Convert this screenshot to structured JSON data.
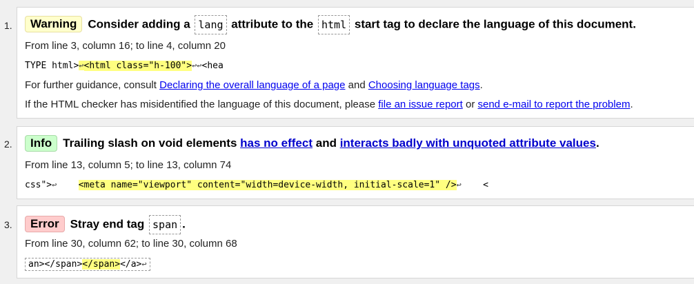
{
  "messages": [
    {
      "number": "1.",
      "type": "Warning",
      "title_parts": [
        "Consider adding a",
        "lang",
        "attribute to the",
        "html",
        "start tag to declare the language of this document."
      ],
      "location": "From line 3, column 16; to line 4, column 20",
      "extract": {
        "before": "TYPE html>",
        "lf1": "↩",
        "highlight": "<html class=\"h-100\">",
        "lf2": "↩↩",
        "after": "<hea"
      },
      "guidance": {
        "prefix": "For further guidance, consult",
        "link1": "Declaring the overall language of a page",
        "and": "and",
        "link2": "Choosing language tags",
        "suffix": "."
      },
      "misidentified": {
        "prefix": "If the HTML checker has misidentified the language of this document, please",
        "link1": "file an issue report",
        "or": "or",
        "link2": "send e-mail to report the problem",
        "suffix": "."
      }
    },
    {
      "number": "2.",
      "type": "Info",
      "title_prefix": "Trailing slash on void elements",
      "link1": "has no effect",
      "and": "and",
      "link2": "interacts badly with unquoted attribute values",
      "title_suffix": ".",
      "location": "From line 13, column 5; to line 13, column 74",
      "extract": {
        "before": "css\">",
        "lf1": "↩",
        "gap": "    ",
        "highlight": "<meta name=\"viewport\" content=\"width=device-width, initial-scale=1\" />",
        "lf2": "↩",
        "after": "    <"
      }
    },
    {
      "number": "3.",
      "type": "Error",
      "title_prefix": "Stray end tag",
      "code": "span",
      "title_suffix": ".",
      "location": "From line 30, column 62; to line 30, column 68",
      "extract": {
        "before": "an></span>",
        "highlight": "</span>",
        "after": "</a>",
        "lf": "↩"
      }
    }
  ]
}
